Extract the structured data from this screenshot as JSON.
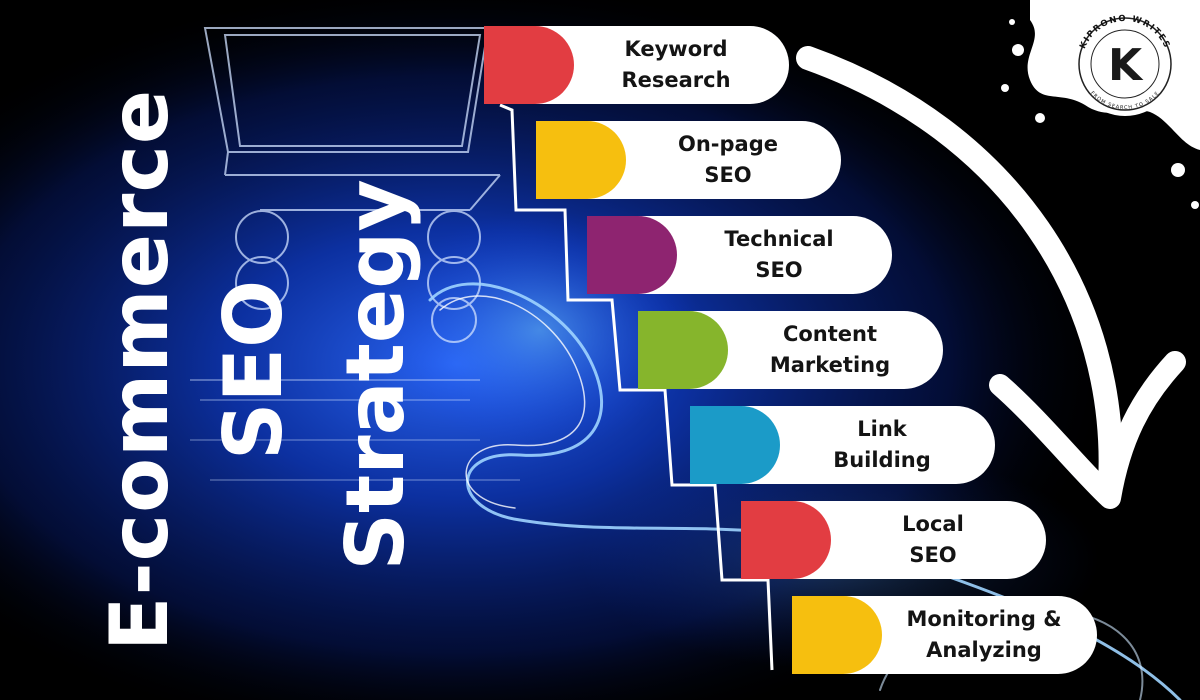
{
  "title_lines": [
    "E-commerce",
    "SEO",
    "Strategy"
  ],
  "steps": [
    {
      "label": "Keyword\nResearch",
      "color": "#e23d42"
    },
    {
      "label": "On-page\nSEO",
      "color": "#f6bf0f"
    },
    {
      "label": "Technical\nSEO",
      "color": "#8e2470"
    },
    {
      "label": "Content\nMarketing",
      "color": "#86b52c"
    },
    {
      "label": "Link\nBuilding",
      "color": "#1b9bc8"
    },
    {
      "label": "Local\nSEO",
      "color": "#e23d42"
    },
    {
      "label": "Monitoring &\nAnalyzing",
      "color": "#f6bf0f"
    }
  ],
  "logo": {
    "name": "KIPRONO WRITES",
    "tagline": "FROM SEARCH TO SALE",
    "letter": "K"
  },
  "colors": {
    "background": "#000000",
    "glow_blue": "#1f6bff",
    "text_white": "#ffffff",
    "pill": "#ffffff"
  },
  "icons": [
    "down-arrow-icon",
    "shopping-cart-illustration",
    "logo-badge"
  ]
}
